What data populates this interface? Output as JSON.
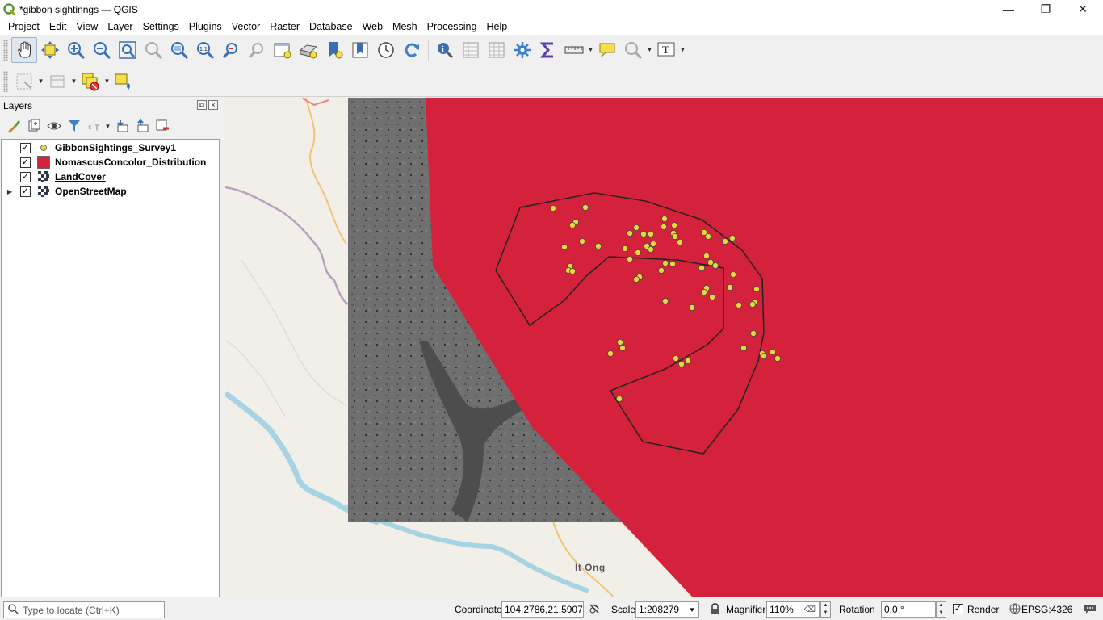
{
  "window": {
    "title": "*gibbon sightinngs — QGIS",
    "controls": {
      "minimize": "—",
      "maximize": "❐",
      "close": "✕"
    }
  },
  "menubar": {
    "items": [
      "Project",
      "Edit",
      "View",
      "Layer",
      "Settings",
      "Plugins",
      "Vector",
      "Raster",
      "Database",
      "Web",
      "Mesh",
      "Processing",
      "Help"
    ]
  },
  "toolbar1": {
    "icons": [
      "pan-map-icon",
      "pan-to-selection-icon",
      "zoom-in-icon",
      "zoom-out-icon",
      "zoom-full-icon",
      "zoom-to-selection-icon",
      "zoom-to-layer-icon",
      "zoom-native-resolution-icon",
      "zoom-last-icon",
      "zoom-next-icon",
      "new-map-view-icon",
      "new-3d-map-view-icon",
      "new-spatial-bookmark-icon",
      "show-bookmarks-icon",
      "temporal-controller-icon",
      "refresh-icon",
      "identify-features-icon",
      "open-attribute-table-icon",
      "statistical-summary-icon",
      "toolbox-icon",
      "field-calculator-icon",
      "measure-line-icon",
      "map-tips-icon",
      "select-features-icon",
      "text-annotation-icon"
    ]
  },
  "toolbar2": {
    "icons": [
      "current-edits-icon",
      "digitize-icon",
      "new-geopackage-layer-icon",
      "add-polygon-icon"
    ]
  },
  "layers_panel": {
    "title": "Layers",
    "toolbar_icons": [
      "style-manager-icon",
      "add-group-icon",
      "manage-visibility-icon",
      "filter-legend-icon",
      "filter-expression-icon",
      "expand-all-icon",
      "collapse-all-icon",
      "remove-layer-icon"
    ],
    "layers": [
      {
        "name": "GibbonSightings_Survey1",
        "checked": true,
        "symbol": "point",
        "color": "#e8d640",
        "underline": false,
        "expandable": false
      },
      {
        "name": "NomascusConcolor_Distribution",
        "checked": true,
        "symbol": "polygon",
        "color": "#d5223c",
        "underline": false,
        "expandable": false
      },
      {
        "name": "LandCover",
        "checked": true,
        "symbol": "raster",
        "underline": true,
        "expandable": false
      },
      {
        "name": "OpenStreetMap",
        "checked": true,
        "symbol": "raster",
        "underline": false,
        "expandable": true
      }
    ]
  },
  "map": {
    "place_label": "It Ong",
    "colors": {
      "background": "#f2efe9",
      "distribution_fill": "#d5223c",
      "sighting_point": "#e8d640",
      "landcover_gray": "#6f6f6f",
      "water": "#a8d3e3"
    }
  },
  "statusbar": {
    "locator_placeholder": "Type to locate (Ctrl+K)",
    "coordinate_label": "Coordinate",
    "coordinate_value": "104.2786,21.5907",
    "scale_label": "Scale",
    "scale_value": "1:208279",
    "magnifier_label": "Magnifier",
    "magnifier_value": "110%",
    "rotation_label": "Rotation",
    "rotation_value": "0.0 °",
    "render_label": "Render",
    "render_checked": true,
    "crs": "EPSG:4326"
  }
}
